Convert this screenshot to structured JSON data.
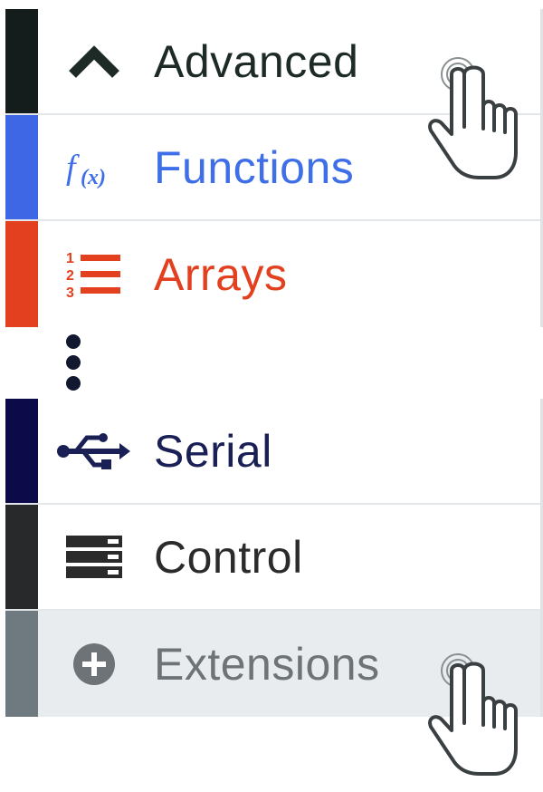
{
  "categories_top": [
    {
      "label": "Advanced",
      "icon": "chevron-up-icon",
      "color": "#1d2a26",
      "stripe": "#141d1b"
    },
    {
      "label": "Functions",
      "icon": "function-fx-icon",
      "color": "#3f6fe8",
      "stripe": "#3e67e6"
    },
    {
      "label": "Arrays",
      "icon": "numbered-list-icon",
      "color": "#e2401e",
      "stripe": "#e2401e"
    }
  ],
  "categories_bottom": [
    {
      "label": "Serial",
      "icon": "usb-icon",
      "color": "#1a2055",
      "stripe": "#0d0a4a"
    },
    {
      "label": "Control",
      "icon": "server-rack-icon",
      "color": "#2b2b2b",
      "stripe": "#27292a"
    },
    {
      "label": "Extensions",
      "icon": "plus-circle-icon",
      "color": "#6d7376",
      "stripe": "#6e7a80"
    }
  ],
  "colors": {
    "selected_background": "#e8ecee",
    "divider": "#e3e7ea"
  }
}
